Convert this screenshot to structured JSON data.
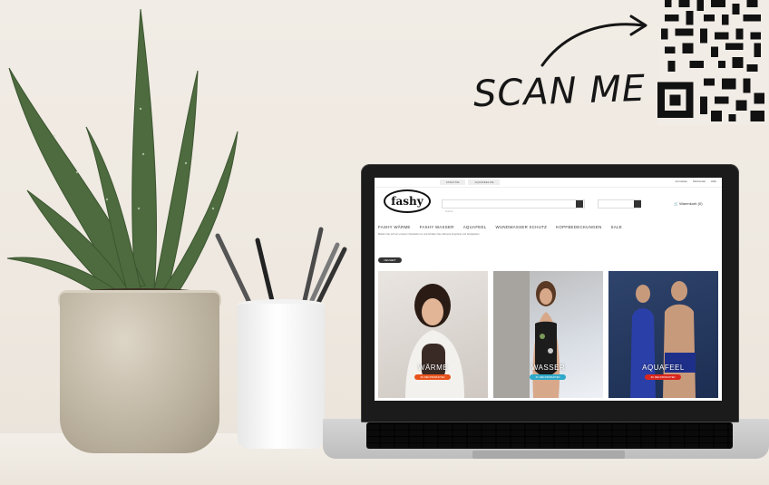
{
  "scene": {
    "scan_label": "SCAN ME",
    "colors": {
      "wall": "#f1ece5",
      "plant": "#4d6b3e",
      "laptop_frame": "#1b1b1b"
    }
  },
  "website": {
    "logo": "fashy",
    "top_tabs": [
      "FASHY.DE",
      "AQUAFEEL.DE"
    ],
    "top_links": [
      "Anmelden",
      "Merkzettel",
      "Hilfe"
    ],
    "search_placeholder": "Suche",
    "cart_label": "Warenkorb (0)",
    "nav": [
      "FASHY WÄRME",
      "FASHY WASSER",
      "AQUAFEEL",
      "WUNDWASSER SCHUTZ",
      "KOPFBEDECKUNGEN",
      "SALE"
    ],
    "notice": "Melden Sie sich an unserem Newsletter an und erhalten Sie exklusive Angebote und Neuigkeiten.",
    "badge": "NEUHEIT",
    "categories": [
      {
        "label": "WÄRME",
        "button": "ZU DEN PRODUKTEN",
        "button_color": "#e8521d"
      },
      {
        "label": "WASSER",
        "button": "ZU DEN PRODUKTEN",
        "button_color": "#2da9c9"
      },
      {
        "label": "AQUAFEEL",
        "button": "ZU DEN PRODUKTEN",
        "button_color": "#d9261c"
      }
    ]
  }
}
